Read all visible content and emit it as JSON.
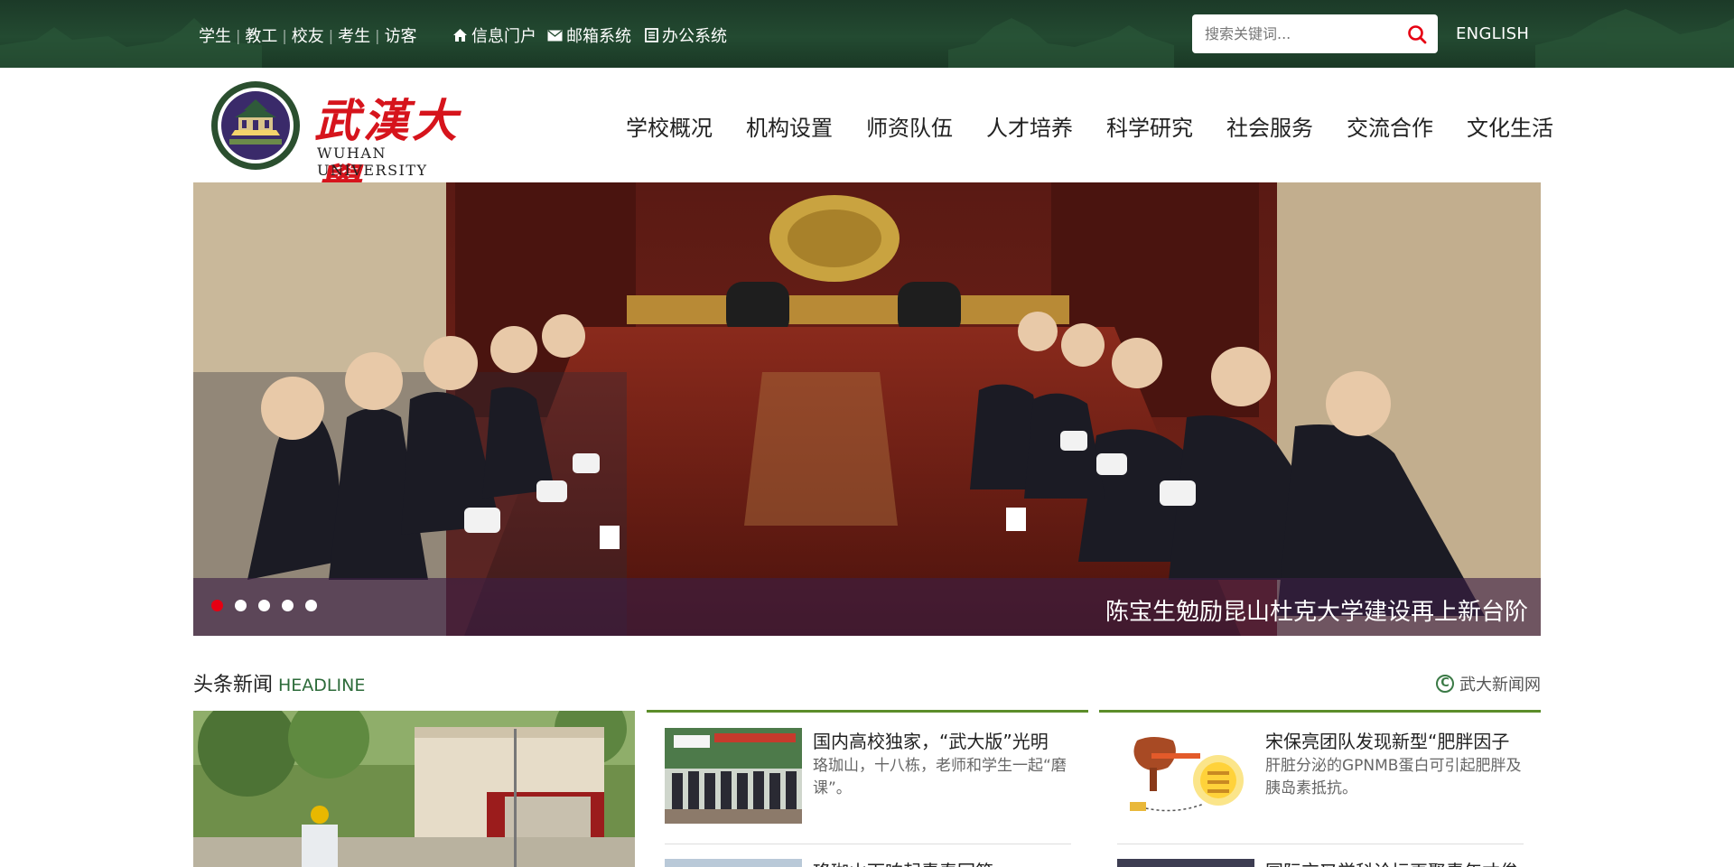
{
  "topbar": {
    "roles": [
      "学生",
      "教工",
      "校友",
      "考生",
      "访客"
    ],
    "systems": [
      {
        "label": "信息门户",
        "icon": "home-icon"
      },
      {
        "label": "邮箱系统",
        "icon": "mail-icon"
      },
      {
        "label": "办公系统",
        "icon": "document-icon"
      }
    ],
    "search_placeholder": "搜索关键词...",
    "search_icon": "search-icon",
    "english_label": "ENGLISH",
    "colors": {
      "background": "#1f4129",
      "search_icon": "#e60012"
    }
  },
  "header": {
    "logo_cn": "武漢大學",
    "logo_en": "WUHAN UNIVERSITY",
    "nav": [
      "学校概况",
      "机构设置",
      "师资队伍",
      "人才培养",
      "科学研究",
      "社会服务",
      "交流合作",
      "文化生活"
    ]
  },
  "banner": {
    "caption": "陈宝生勉励昆山杜克大学建设再上新台阶",
    "slide_count": 5,
    "active_slide": 1
  },
  "headline": {
    "title": "头条新闻",
    "title_en": "HEADLINE",
    "more_label": "武大新闻网",
    "more_icon": "copyright-c-icon",
    "accent_color": "#5c8d2a",
    "columns": [
      {
        "items": [
          {
            "title": "国内高校独家，“武大版”光明",
            "desc": "珞珈山，十八栋，老师和学生一起“磨课”。"
          },
          {
            "title": "珞珈山下响起青春回答"
          }
        ]
      },
      {
        "items": [
          {
            "title": "宋保亮团队发现新型“肥胖因子",
            "desc": "肝脏分泌的GPNMB蛋白可引起肥胖及胰岛素抵抗。"
          },
          {
            "title": "国际交叉学科论坛再聚青年才俊"
          }
        ]
      }
    ]
  }
}
